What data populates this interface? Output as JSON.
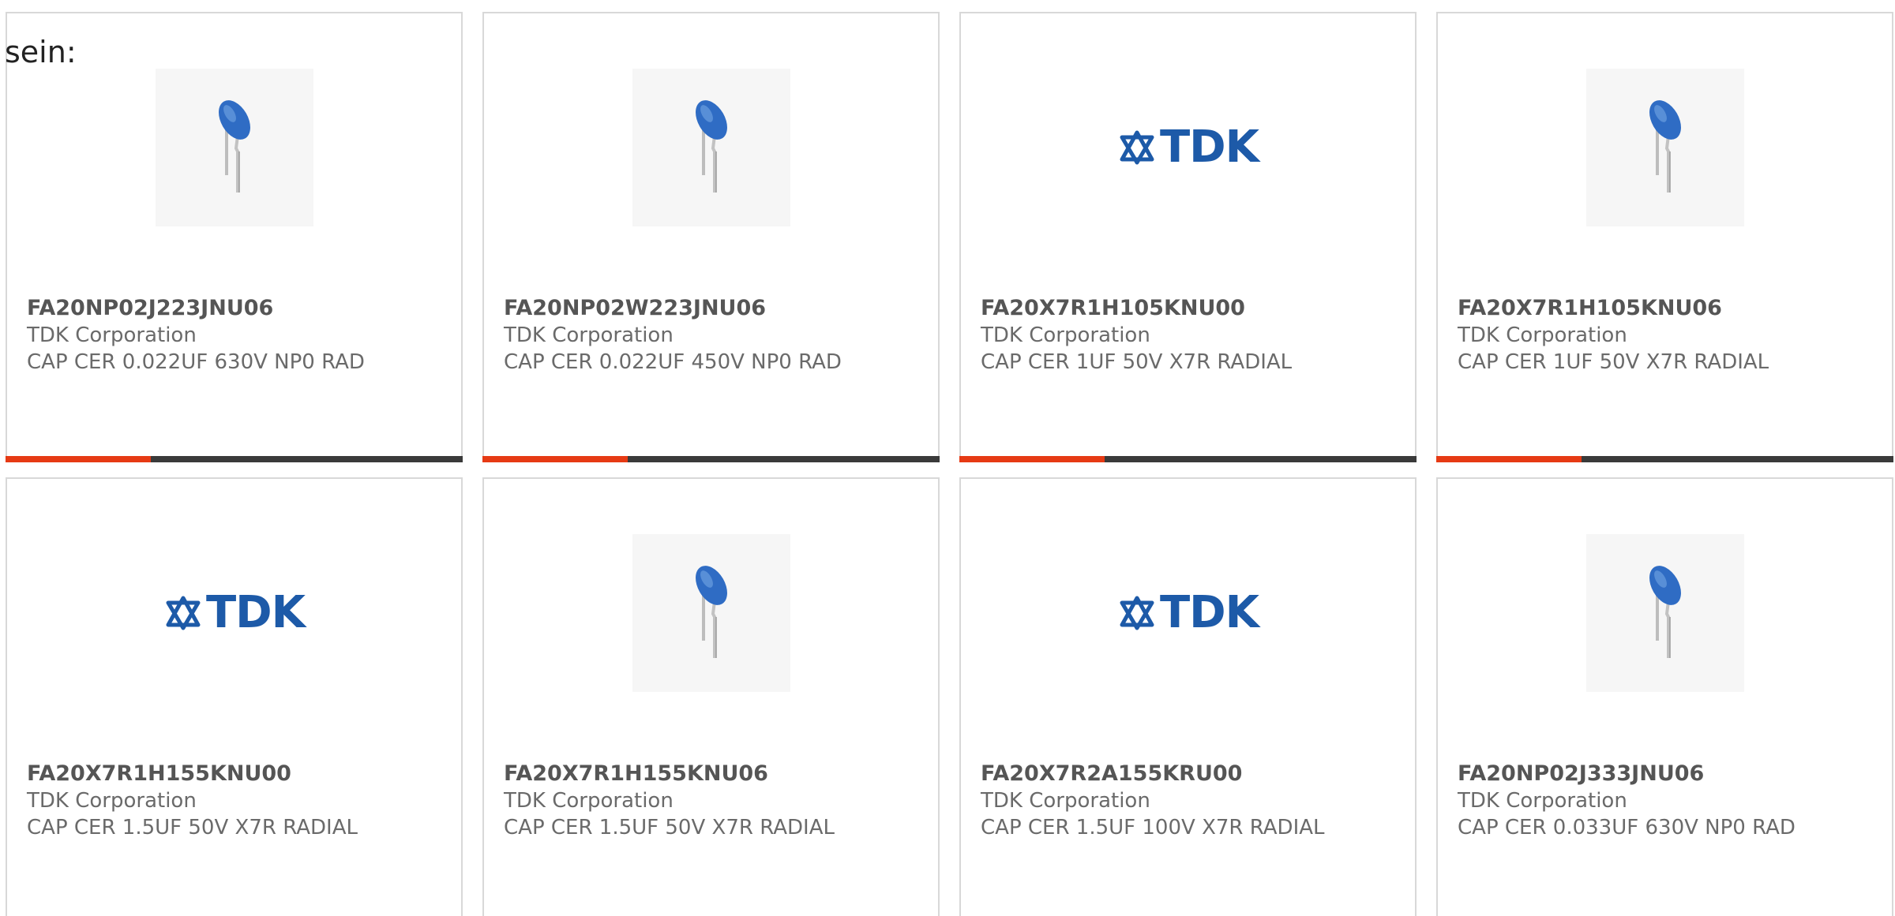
{
  "intro_text": "sein:",
  "colors": {
    "accent_bar": "#e63a14",
    "bar_dark": "#3a3a3a",
    "tdk_blue": "#1d5aa8",
    "capacitor_blue": "#2f6cc4"
  },
  "cards": [
    {
      "part": "FA20NP02J223JNU06",
      "mfr": "TDK Corporation",
      "desc": "CAP CER 0.022UF 630V NP0 RAD",
      "image": "capacitor-photo"
    },
    {
      "part": "FA20NP02W223JNU06",
      "mfr": "TDK Corporation",
      "desc": "CAP CER 0.022UF 450V NP0 RAD",
      "image": "capacitor-photo"
    },
    {
      "part": "FA20X7R1H105KNU00",
      "mfr": "TDK Corporation",
      "desc": "CAP CER 1UF 50V X7R RADIAL",
      "image": "tdk-logo",
      "logo_text": "TDK"
    },
    {
      "part": "FA20X7R1H105KNU06",
      "mfr": "TDK Corporation",
      "desc": "CAP CER 1UF 50V X7R RADIAL",
      "image": "capacitor-photo"
    },
    {
      "part": "FA20X7R1H155KNU00",
      "mfr": "TDK Corporation",
      "desc": "CAP CER 1.5UF 50V X7R RADIAL",
      "image": "tdk-logo",
      "logo_text": "TDK"
    },
    {
      "part": "FA20X7R1H155KNU06",
      "mfr": "TDK Corporation",
      "desc": "CAP CER 1.5UF 50V X7R RADIAL",
      "image": "capacitor-photo"
    },
    {
      "part": "FA20X7R2A155KRU00",
      "mfr": "TDK Corporation",
      "desc": "CAP CER 1.5UF 100V X7R RADIAL",
      "image": "tdk-logo",
      "logo_text": "TDK"
    },
    {
      "part": "FA20NP02J333JNU06",
      "mfr": "TDK Corporation",
      "desc": "CAP CER 0.033UF 630V NP0 RAD",
      "image": "capacitor-photo"
    }
  ]
}
